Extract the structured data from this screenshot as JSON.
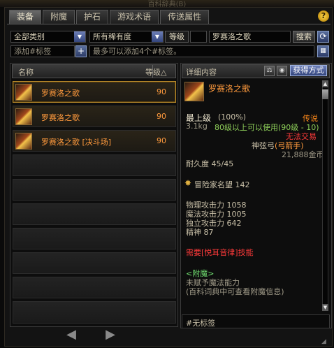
{
  "window": {
    "title": "百科辞典(B)"
  },
  "tabs": [
    {
      "label": "装备",
      "active": true
    },
    {
      "label": "附魔",
      "active": false
    },
    {
      "label": "护石",
      "active": false
    },
    {
      "label": "游戏术语",
      "active": false
    },
    {
      "label": "传送属性",
      "active": false
    }
  ],
  "help_label": "?",
  "filters": {
    "category": "全部类别",
    "rarity": "所有稀有度",
    "level_label": "等级",
    "level_value": "",
    "search_value": "罗赛洛之歌",
    "search_button": "搜索",
    "refresh_icon": "refresh-icon",
    "tag_placeholder": "添加#标签",
    "tag_add": "+",
    "tag_hint": "最多可以添加4个#标签。"
  },
  "list": {
    "col_name": "名称",
    "col_level": "等级△",
    "items": [
      {
        "name": "罗赛洛之歌",
        "level": "90",
        "selected": true
      },
      {
        "name": "罗赛洛之歌",
        "level": "90",
        "selected": false
      },
      {
        "name": "罗赛洛之歌 [决斗场]",
        "level": "90",
        "selected": false
      }
    ],
    "empty_rows": 8,
    "prev_label": "◀",
    "next_label": "▶"
  },
  "detail": {
    "header": "详细内容",
    "obtain_button": "获得方式",
    "item_name": "罗赛洛之歌",
    "grade": "最上级",
    "grade_pct": "(100%)",
    "rarity": "传说",
    "weight": "3.1kg",
    "level_req": "80级以上可以使用(90级 - 10)",
    "trade": "无法交易",
    "weapon_type": "神弦弓",
    "class": "(弓箭手)",
    "price": "21,888金币",
    "durability": "耐久度 45/45",
    "adventurer": "冒险家名望 142",
    "stats": [
      "物理攻击力 1058",
      "魔法攻击力 1005",
      "独立攻击力 642",
      "精神 87"
    ],
    "requirement": "需要[悦耳音律]技能",
    "enchant_title": "<附魔>",
    "enchant_none": "未赋予魔法能力",
    "enchant_hint": "(百科词典中可查看附魔信息)",
    "tag": "#无标签"
  },
  "colors": {
    "orange": "#ff9a3d",
    "legend": "#ff8a1a",
    "green": "#8fd05a",
    "red": "#ff3a3a",
    "enchant": "#6fdc6f"
  }
}
